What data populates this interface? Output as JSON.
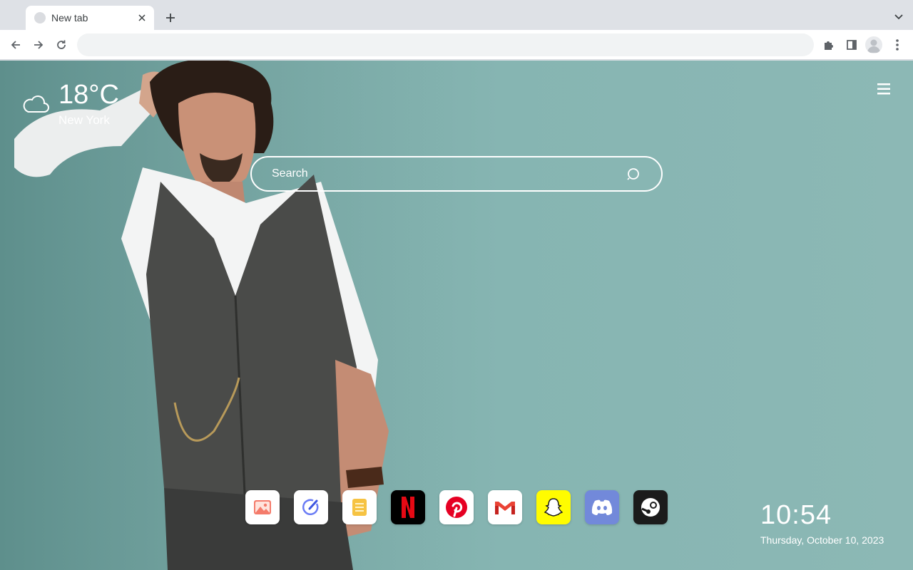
{
  "browser": {
    "tab": {
      "title": "New tab"
    },
    "omnibox": {
      "value": "",
      "placeholder": ""
    }
  },
  "weather": {
    "temperature": "18°C",
    "city": "New York",
    "icon": "cloud-icon"
  },
  "search": {
    "placeholder": "Search"
  },
  "dock": {
    "apps": [
      {
        "name": "Photos",
        "icon": "photos-icon",
        "bg": "#ffffff"
      },
      {
        "name": "Tasks",
        "icon": "tasks-icon",
        "bg": "#ffffff"
      },
      {
        "name": "Notes",
        "icon": "notes-icon",
        "bg": "#ffffff"
      },
      {
        "name": "Netflix",
        "icon": "netflix-icon",
        "bg": "#000000"
      },
      {
        "name": "Pinterest",
        "icon": "pinterest-icon",
        "bg": "#ffffff"
      },
      {
        "name": "Gmail",
        "icon": "gmail-icon",
        "bg": "#ffffff"
      },
      {
        "name": "Snapchat",
        "icon": "snapchat-icon",
        "bg": "#fffc00"
      },
      {
        "name": "Discord",
        "icon": "discord-icon",
        "bg": "#7289da"
      },
      {
        "name": "Steam",
        "icon": "steam-icon",
        "bg": "#1b1b1b"
      }
    ]
  },
  "clock": {
    "time": "10:54",
    "date": "Thursday, October 10, 2023"
  },
  "colors": {
    "accent": "#ffffff",
    "wallpaper": "#8cb8b5",
    "chrome": "#dee1e6"
  }
}
